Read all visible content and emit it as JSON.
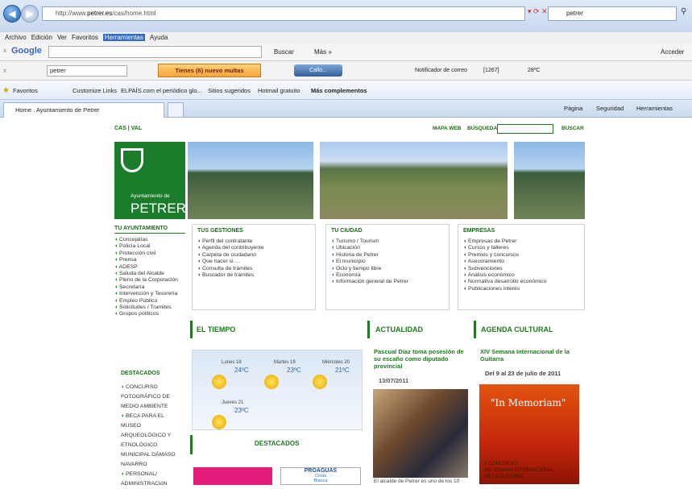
{
  "browser": {
    "url_prefix": "http://www.",
    "url_domain": "petrer.es",
    "url_path": "/cas/home.html",
    "search": "petrer"
  },
  "menu": [
    "Archivo",
    "Edición",
    "Ver",
    "Favoritos",
    "Herramientas",
    "Ayuda"
  ],
  "google": {
    "label": "Google",
    "search_btn": "Buscar",
    "more": "Más »",
    "signin": "Acceder"
  },
  "toolbar": {
    "query": "petrer",
    "alert": "Tienes (6) nuevo multas",
    "calls": "Callo...",
    "mail": "Notificador de correo",
    "count": "[1267]",
    "temp": "28ºC"
  },
  "favbar": {
    "favorites": "Favoritos",
    "links": [
      "Customize Links",
      "ELPAÍS.com el periódico glo...",
      "Sitios sugeridos",
      "Hotmail gratuito",
      "Más complementos"
    ]
  },
  "tabbar": {
    "tab": "Home . Ayuntamiento de Petrer",
    "page": "Página",
    "security": "Seguridad",
    "tools": "Herramientas"
  },
  "site": {
    "lang": "CAS | VAL",
    "mapa": "MAPA WEB",
    "busqueda": "BÚSQUEDA",
    "buscar": "BUSCAR",
    "logo_line1": "Ayuntamiento de",
    "logo_line2": "PETRER",
    "ayto": {
      "title": "TU AYUNTAMIENTO",
      "items": [
        "Concejalías",
        "Policía Local",
        "Protección civil",
        "Prensa",
        "ADESP",
        "Saluda del Alcalde",
        "Pleno de la Corporación",
        "Secretaría",
        "Intervención y Tesorería",
        "Empleo Público",
        "Solicitudes / Tramites",
        "Grupos políticos"
      ]
    },
    "gestiones": {
      "title": "TUS GESTIONES",
      "items": [
        "Perfil del contratante",
        "Agenda del contribuyente",
        "Carpeta de ciudadano",
        "Que hacer si ...",
        "Consulta de trámites",
        "Buscador de trámites"
      ]
    },
    "ciudad": {
      "title": "TU CIUDAD",
      "items": [
        "Turismo / Tourism",
        "Ubicación",
        "Historia de Petrer",
        "El municipio",
        "Ocio y tiempo libre",
        "Economía",
        "Información general de Petrer"
      ]
    },
    "empresas": {
      "title": "EMPRESAS",
      "items": [
        "Empresas de Petrer",
        "Cursos y talleres",
        "Premios y concursos",
        "Asesoramiento",
        "Subvenciones",
        "Análisis económico",
        "Normativa desarrollo económico",
        "Publicaciones interés"
      ]
    },
    "destacados_left": {
      "title": "DESTACADOS",
      "items": [
        "CONCURSO FOTOGRÁFICO DE MEDIO AMBIENTE",
        "BECA PARA EL MUSEO ARQUEOLÓGICO Y ETNOLÓGICO MUNICIPAL DÁMASO NAVARRO",
        "PERSONAL/ ADMINISTRACIóN"
      ]
    },
    "tiempo": {
      "title": "EL TIEMPO",
      "days": [
        {
          "day": "Lunes 18",
          "temp": "24ºC"
        },
        {
          "day": "Martes 19",
          "temp": "23ºC"
        },
        {
          "day": "Miércoles 20",
          "temp": "21ºC"
        },
        {
          "day": "Jueves 21",
          "temp": "23ºC"
        }
      ]
    },
    "destacados_mid": {
      "title": "DESTACADOS",
      "proaguas": "PROAGUAS",
      "costa": "Costa",
      "blanca": "Blanca"
    },
    "actualidad": {
      "title": "ACTUALIDAD",
      "headline": "Pascual Díaz toma posesión de su escaño como diputado provincial",
      "date": "13/07/2011",
      "caption": "El alcalde de Petrer es uno de los 10"
    },
    "agenda": {
      "title": "AGENDA CULTURAL",
      "headline": "XIV Semana Internacional de la Guitarra",
      "dates": "Del 9 al 23 de julio de 2011",
      "poster": "\"In Memoriam\"",
      "poster_l1": "X CONCURSO",
      "poster_l2": "XIV SEMANA INTERNACIONAL",
      "poster_l3": "DE LA GUITARRA"
    }
  }
}
